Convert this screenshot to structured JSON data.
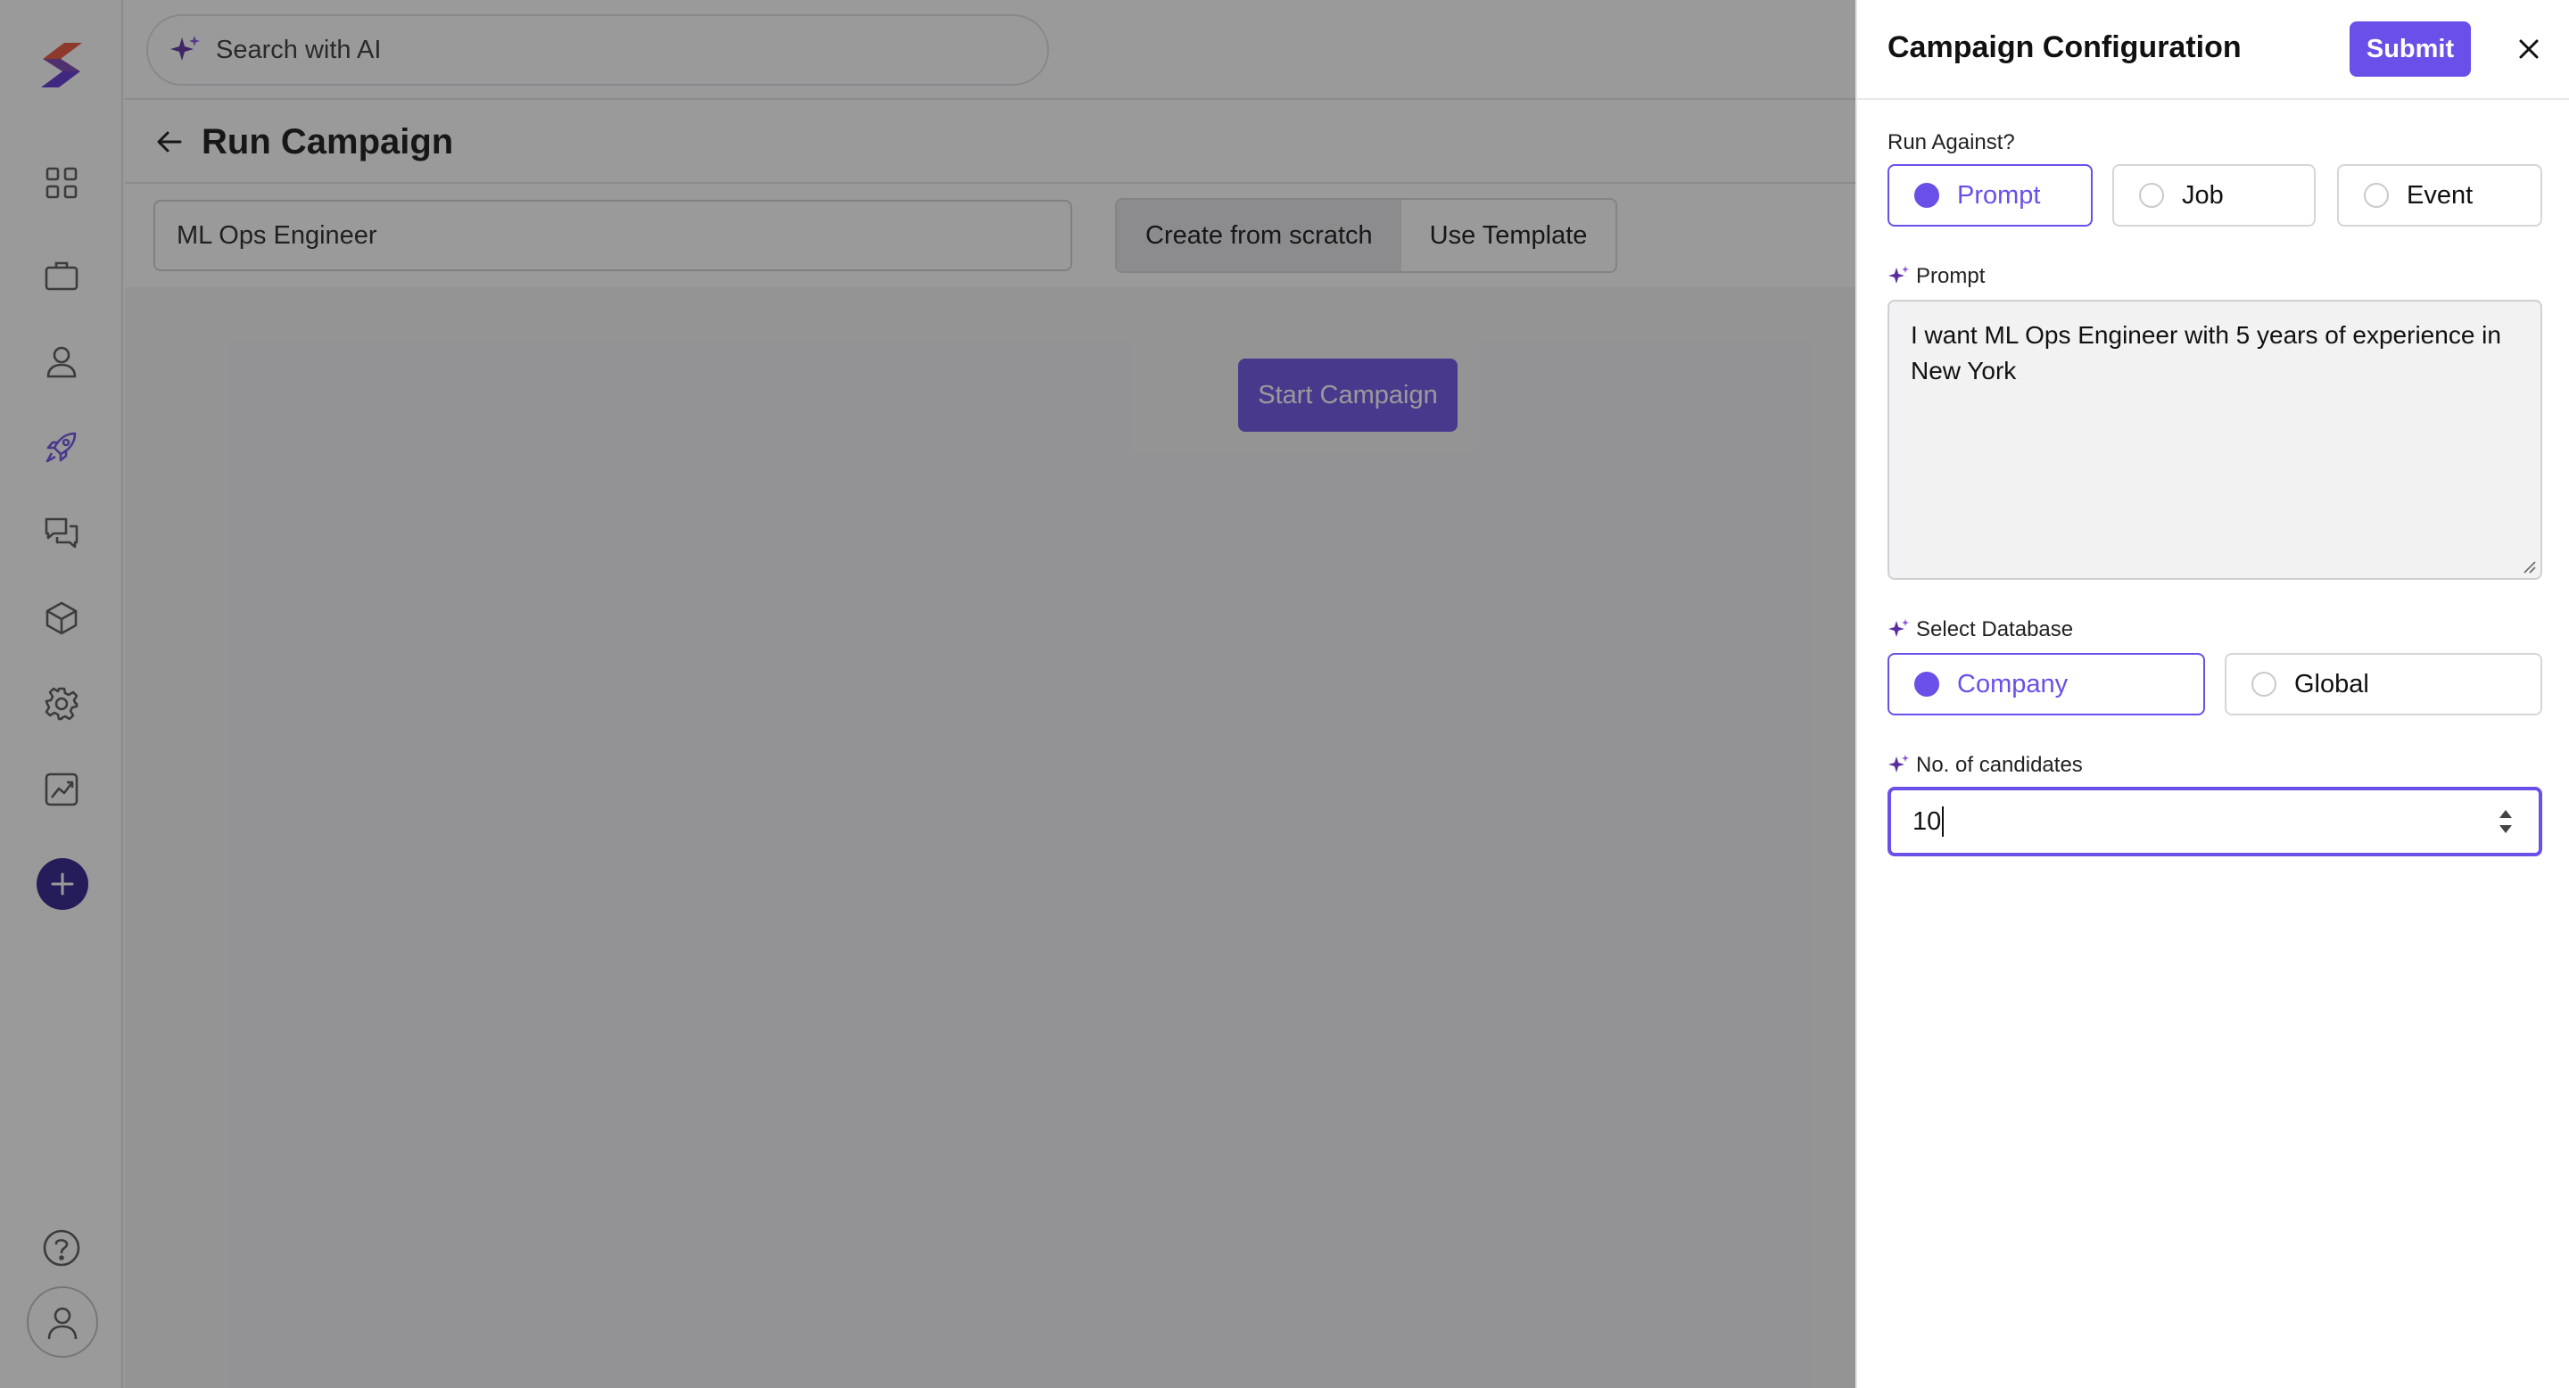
{
  "search": {
    "label": "Search with AI"
  },
  "page": {
    "title": "Run Campaign"
  },
  "toolbar": {
    "campaign_name": "ML Ops Engineer",
    "create_from_scratch": "Create from scratch",
    "use_template": "Use Template"
  },
  "main": {
    "start_campaign": "Start Campaign"
  },
  "panel": {
    "title": "Campaign Configuration",
    "submit": "Submit",
    "run_against_label": "Run Against?",
    "run_against_options": [
      "Prompt",
      "Job",
      "Event"
    ],
    "run_against_selected": "Prompt",
    "prompt_label": "Prompt",
    "prompt_value": "I want ML Ops Engineer with 5 years of experience in New York",
    "database_label": "Select Database",
    "database_options": [
      "Company",
      "Global"
    ],
    "database_selected": "Company",
    "candidates_label": "No. of candidates",
    "candidates_value": "10"
  },
  "colors": {
    "accent": "#6a4fe8",
    "sidebar_active": "#6a4fe8",
    "add_button": "#2a1a8a"
  },
  "icons": {
    "sidebar": [
      "dashboard-icon",
      "briefcase-icon",
      "user-icon",
      "rocket-icon",
      "chat-icon",
      "cube-icon",
      "gear-icon",
      "chart-icon"
    ]
  }
}
